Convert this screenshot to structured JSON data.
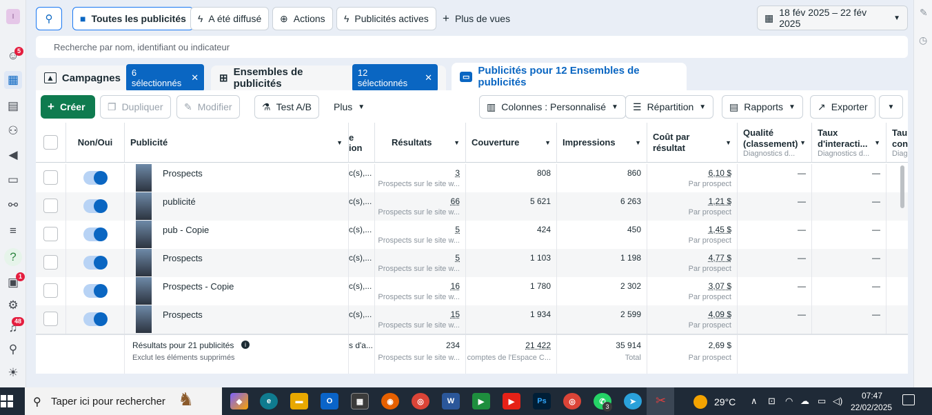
{
  "nav": {
    "avatar_letter": "I",
    "notifications_badge": "5",
    "alerts_badge": "1",
    "bell_badge": "48"
  },
  "filters": {
    "all_ads": "Toutes les publicités",
    "delivered": "A été diffusé",
    "actions": "Actions",
    "active_ads": "Publicités actives",
    "more_views": "Plus de vues",
    "date_range": "18 fév 2025 – 22 fév 2025"
  },
  "search": {
    "placeholder": "Recherche par nom, identifiant ou indicateur"
  },
  "tabs": {
    "campaigns": "Campagnes",
    "campaigns_chip": "6 sélectionnés",
    "adsets": "Ensembles de publicités",
    "adsets_chip": "12 sélectionnés",
    "ads": "Publicités pour 12 Ensembles de publicités"
  },
  "toolbar": {
    "create": "Créer",
    "duplicate": "Dupliquer",
    "edit": "Modifier",
    "ab_test": "Test A/B",
    "more": "Plus",
    "columns": "Colonnes : Personnalisé",
    "breakdown": "Répartition",
    "reports": "Rapports",
    "export": "Exporter"
  },
  "table": {
    "headers": {
      "onoff": "Non/Oui",
      "ad": "Publicité",
      "clipped_top": "e",
      "clipped_bottom": "ion",
      "results": "Résultats",
      "reach": "Couverture",
      "impressions": "Impressions",
      "cpr": "Coût par résultat",
      "quality": "Qualité (classement)",
      "quality_sub": "Diagnostics d...",
      "engagement": "Taux d'interacti...",
      "engagement_sub": "Diagnostics d...",
      "conv_top": "Tau",
      "conv_bottom": "con",
      "conv_sub": "Diag"
    },
    "rows": [
      {
        "name": "Prospects",
        "clipped": "c(s),...",
        "results": "3",
        "results_sub": "Prospects sur le site w...",
        "reach": "808",
        "impressions": "860",
        "cpr": "6,10 $",
        "cpr_sub": "Par prospect",
        "quality": "—",
        "engagement": "—"
      },
      {
        "name": "publicité",
        "clipped": "c(s),...",
        "results": "66",
        "results_sub": "Prospects sur le site w...",
        "reach": "5 621",
        "impressions": "6 263",
        "cpr": "1,21 $",
        "cpr_sub": "Par prospect",
        "quality": "—",
        "engagement": "—"
      },
      {
        "name": "pub - Copie",
        "clipped": "c(s),...",
        "results": "5",
        "results_sub": "Prospects sur le site w...",
        "reach": "424",
        "impressions": "450",
        "cpr": "1,45 $",
        "cpr_sub": "Par prospect",
        "quality": "—",
        "engagement": "—"
      },
      {
        "name": "Prospects",
        "clipped": "c(s),...",
        "results": "5",
        "results_sub": "Prospects sur le site w...",
        "reach": "1 103",
        "impressions": "1 198",
        "cpr": "4,77 $",
        "cpr_sub": "Par prospect",
        "quality": "—",
        "engagement": "—"
      },
      {
        "name": "Prospects - Copie",
        "clipped": "c(s),...",
        "results": "16",
        "results_sub": "Prospects sur le site w...",
        "reach": "1 780",
        "impressions": "2 302",
        "cpr": "3,07 $",
        "cpr_sub": "Par prospect",
        "quality": "—",
        "engagement": "—"
      },
      {
        "name": "Prospects",
        "clipped": "c(s),...",
        "results": "15",
        "results_sub": "Prospects sur le site w...",
        "reach": "1 934",
        "impressions": "2 599",
        "cpr": "4,09 $",
        "cpr_sub": "Par prospect",
        "quality": "—",
        "engagement": "—"
      }
    ],
    "totals": {
      "label": "Résultats pour 21 publicités",
      "sublabel": "Exclut les éléments supprimés",
      "clipped": "s d'a...",
      "results": "234",
      "results_sub": "Prospects sur le site w...",
      "reach": "21 422",
      "reach_sub": "comptes de l'Espace C...",
      "impressions": "35 914",
      "impressions_sub": "Total",
      "cpr": "2,69 $",
      "cpr_sub": "Par prospect"
    }
  },
  "taskbar": {
    "search": "Taper ici pour rechercher",
    "temp": "29°C",
    "time": "07:47",
    "date": "22/02/2025",
    "whatsapp_badge": "3"
  }
}
